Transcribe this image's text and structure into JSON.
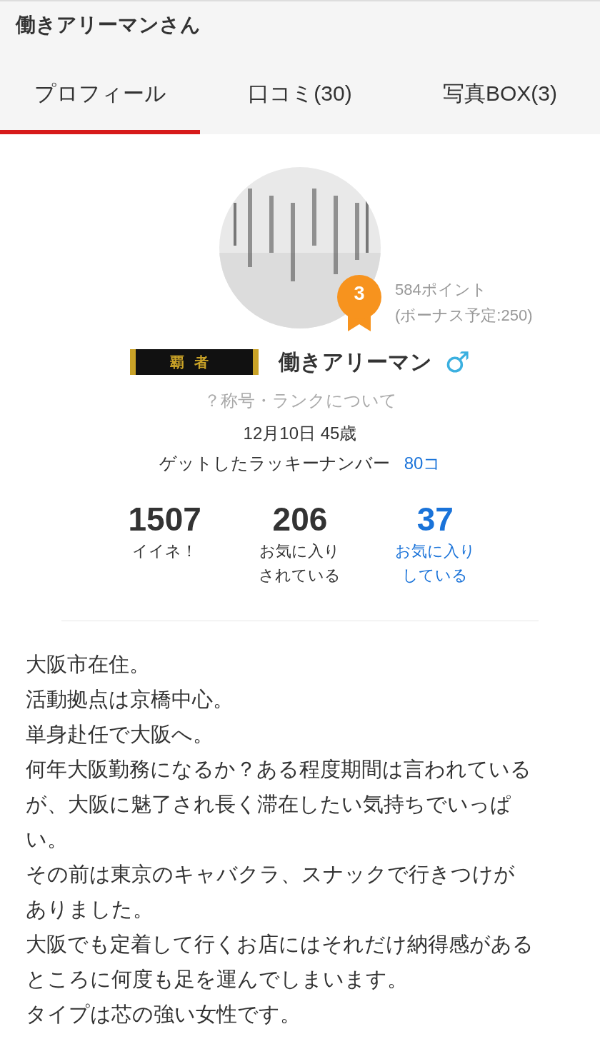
{
  "header": {
    "title": "働きアリーマンさん"
  },
  "tabs": [
    {
      "label": "プロフィール",
      "selected": true
    },
    {
      "label": "口コミ(30)",
      "selected": false
    },
    {
      "label": "写真BOX(3)",
      "selected": false
    }
  ],
  "profile": {
    "rank": "3",
    "points": "584ポイント",
    "bonus": "(ボーナス予定:250)",
    "rank_title": "覇者",
    "name": "働きアリーマン",
    "gender_symbol": "♂",
    "rank_help": "？称号・ランクについて",
    "birthday_age": "12月10日 45歳",
    "lucky_label": "ゲットしたラッキーナンバー",
    "lucky_count": "80コ"
  },
  "stats": [
    {
      "value": "1507",
      "label": [
        "イイネ！"
      ],
      "kind": "count"
    },
    {
      "value": "206",
      "label": [
        "お気に入り",
        "されている"
      ],
      "kind": "count"
    },
    {
      "value": "37",
      "label": [
        "お気に入り",
        "している"
      ],
      "kind": "link"
    }
  ],
  "bio": [
    "大阪市在住。",
    "活動拠点は京橋中心。",
    "単身赴任で大阪へ。",
    "何年大阪勤務になるか？ある程度期間は言われているが、大阪に魅了され長く滞在したい気持ちでいっぱい。",
    "その前は東京のキャバクラ、スナックで行きつけがありました。",
    "大阪でも定着して行くお店にはそれだけ納得感があるところに何度も足を運んでしまいます。",
    "タイプは芯の強い女性です。"
  ]
}
